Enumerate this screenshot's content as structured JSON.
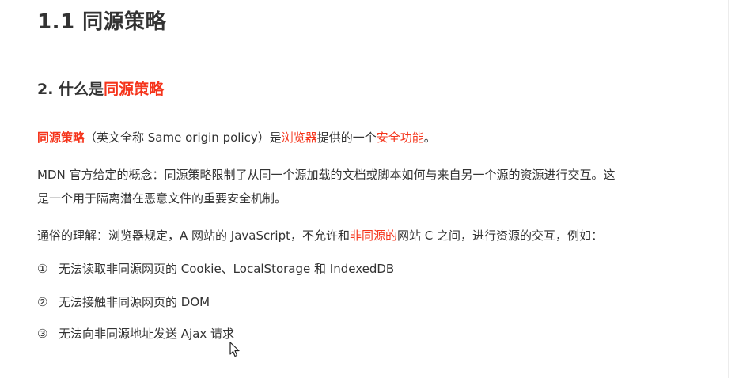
{
  "doc": {
    "section_title": "1.1 同源策略",
    "subsection": {
      "prefix": "2. 什么是",
      "highlight": "同源策略"
    },
    "para1": {
      "term": "同源策略",
      "text1": "（英文全称 Same origin policy）是",
      "link1": "浏览器",
      "text2": "提供的一个",
      "link2": "安全功能",
      "text3": "。"
    },
    "para2": {
      "line1": "MDN 官方给定的概念：同源策略限制了从同一个源加载的文档或脚本如何与来自另一个源的资源进行交互。这",
      "line2": "是一个用于隔离潜在恶意文件的重要安全机制。"
    },
    "para3": {
      "text1": "通俗的理解：浏览器规定，A 网站的 JavaScript，不允许和",
      "highlight": "非同源的",
      "text2": "网站 C 之间，进行资源的交互，例如："
    },
    "list": [
      {
        "num": "①",
        "text": "无法读取非同源网页的 Cookie、LocalStorage 和 IndexedDB"
      },
      {
        "num": "②",
        "text": "无法接触非同源网页的 DOM"
      },
      {
        "num": "③",
        "text": "无法向非同源地址发送 Ajax 请求"
      }
    ],
    "colors": {
      "text": "#333333",
      "accent": "#f5341b"
    },
    "icons": {
      "cursor": "mouse-pointer-icon"
    }
  }
}
